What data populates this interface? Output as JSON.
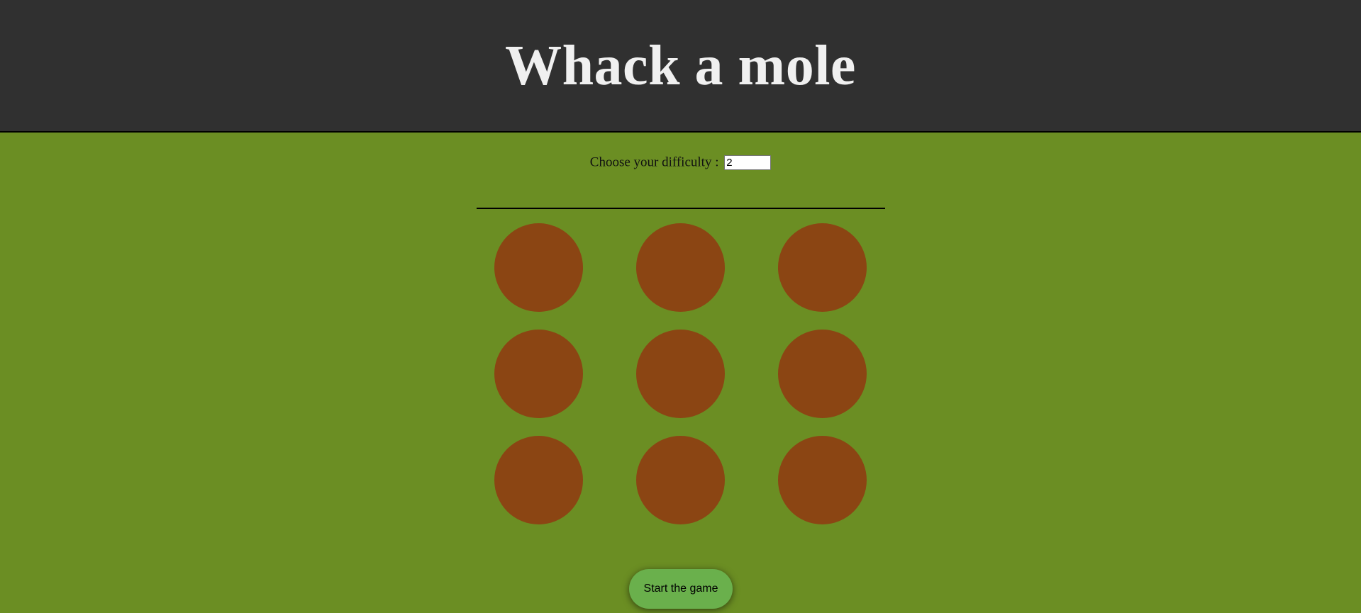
{
  "header": {
    "title": "Whack a mole"
  },
  "difficulty": {
    "label": "Choose your difficulty :",
    "value": "2"
  },
  "board": {
    "rows": 3,
    "columns": 3,
    "holes": [
      "",
      "",
      "",
      "",
      "",
      "",
      "",
      "",
      ""
    ]
  },
  "controls": {
    "start_label": "Start the game"
  },
  "colors": {
    "header_background": "#303030",
    "title_text": "#f0f0f0",
    "field_background": "#6b8e23",
    "hole": "#8b4513",
    "start_button": "#6ab04c"
  }
}
